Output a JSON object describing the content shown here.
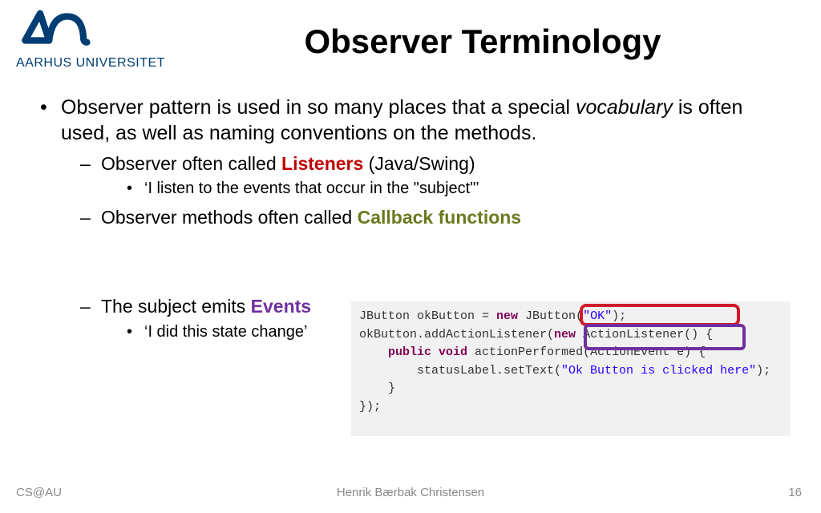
{
  "logo": {
    "text": "AARHUS UNIVERSITET"
  },
  "title": "Observer Terminology",
  "bullets": {
    "p1a": "Observer pattern is used in so many places that a special ",
    "p1b": "vocabulary",
    "p1c": " is often used, as well as naming conventions on the methods.",
    "s1a": "Observer often called      ",
    "s1_listeners": "Listeners",
    "s1b": "         (Java/Swing)",
    "s1_sub": "‘I listen to the events that occur in the \"subject\"’",
    "s2a": "Observer methods often called ",
    "s2_cb": "Callback functions",
    "s3a": "The subject emits ",
    "s3_ev": "Events",
    "s3_sub": "‘I did this state change’"
  },
  "code": {
    "l1_a": "JButton okButton = ",
    "l1_new": "new",
    "l1_b": " JButton(",
    "l1_str": "\"OK\"",
    "l1_c": ");",
    "l2_a": "okButton.addActionListener(",
    "l2_new": "new",
    "l2_b": " ActionListener() {",
    "l3_a": "    ",
    "l3_pub": "public void",
    "l3_b": " actionPerformed(ActionEvent e) {",
    "l4_a": "        statusLabel.setText(",
    "l4_str": "\"Ok Button is clicked here\"",
    "l4_b": ");",
    "l5": "    }",
    "l6": "});"
  },
  "footer": {
    "left": "CS@AU",
    "center": "Henrik Bærbak Christensen",
    "right": "16"
  }
}
